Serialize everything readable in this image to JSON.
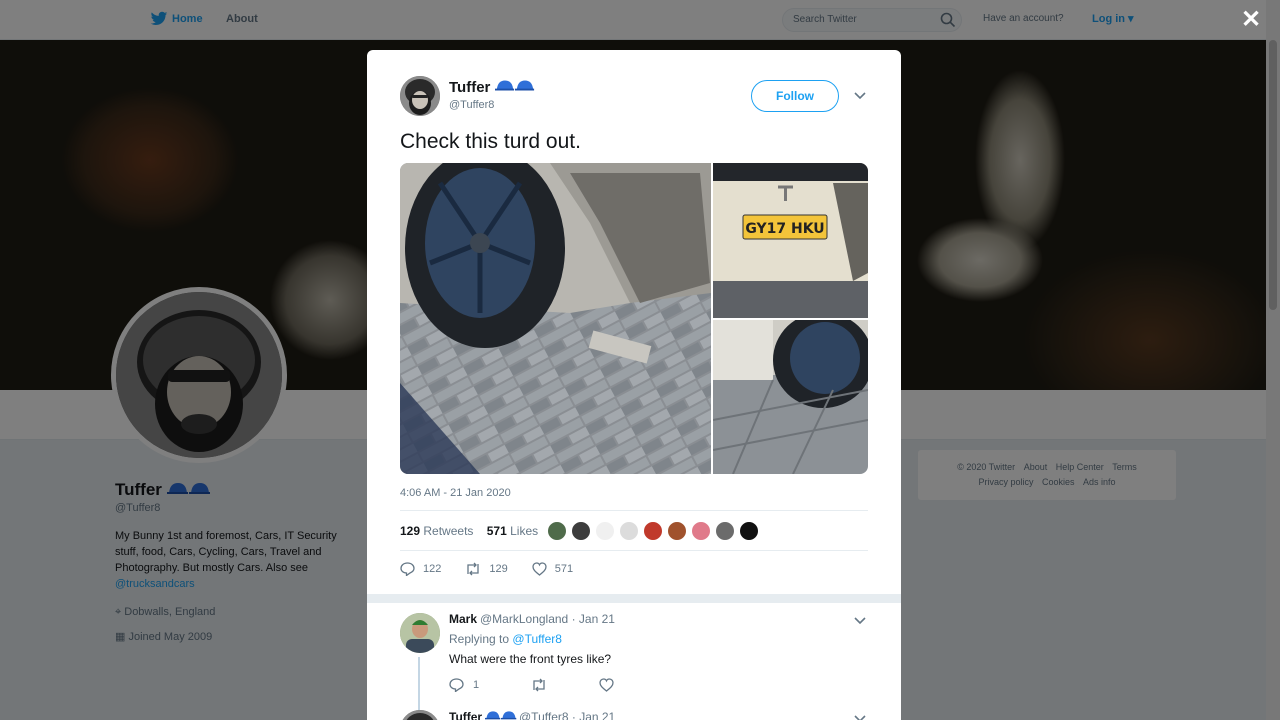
{
  "topbar": {
    "home_label": "Home",
    "about_label": "About",
    "search_placeholder": "Search Twitter",
    "account_prompt": "Have an account?",
    "login_label": "Log in ▾"
  },
  "profile": {
    "name": "Tuffer",
    "handle": "@Tuffer8",
    "bio": "My Bunny 1st and foremost, Cars, IT Security stuff, food, Cars, Cycling, Cars, Travel and Photography. But mostly Cars. Also see ",
    "bio_link": "@trucksandcars",
    "location": "Dobwalls, England",
    "joined": "Joined May 2009"
  },
  "footer": {
    "links": [
      "© 2020 Twitter",
      "About",
      "Help Center",
      "Terms",
      "Privacy policy",
      "Cookies",
      "Ads info"
    ]
  },
  "modal": {
    "author_name": "Tuffer",
    "author_handle": "@Tuffer8",
    "follow_label": "Follow",
    "tweet_text": "Check this turd out.",
    "plate_text": "GY17 HKU",
    "timestamp": "4:06 AM - 21 Jan 2020",
    "retweets_count": "129",
    "retweets_label": "Retweets",
    "likes_count": "571",
    "likes_label": "Likes",
    "action_reply_count": "122",
    "action_retweet_count": "129",
    "action_like_count": "571",
    "liker_colors": [
      "#4f6b4a",
      "#3d3d3d",
      "#f0f0f0",
      "#dcdcdc",
      "#c0392b",
      "#a0522d",
      "#e07a8a",
      "#6b6b6b",
      "#111111"
    ]
  },
  "reply": {
    "name": "Mark",
    "handle_date": "@MarkLongland · Jan 21",
    "replying_prefix": "Replying to",
    "replying_to": "@Tuffer8",
    "text": "What were the front tyres like?",
    "reply_count": "1",
    "retweet_count": "",
    "like_count": ""
  },
  "reply2": {
    "name": "Tuffer",
    "handle_date": "@Tuffer8 · Jan 21"
  },
  "colors": {
    "accent": "#1da1f2",
    "muted": "#657786",
    "divider": "#e6ecf0"
  }
}
